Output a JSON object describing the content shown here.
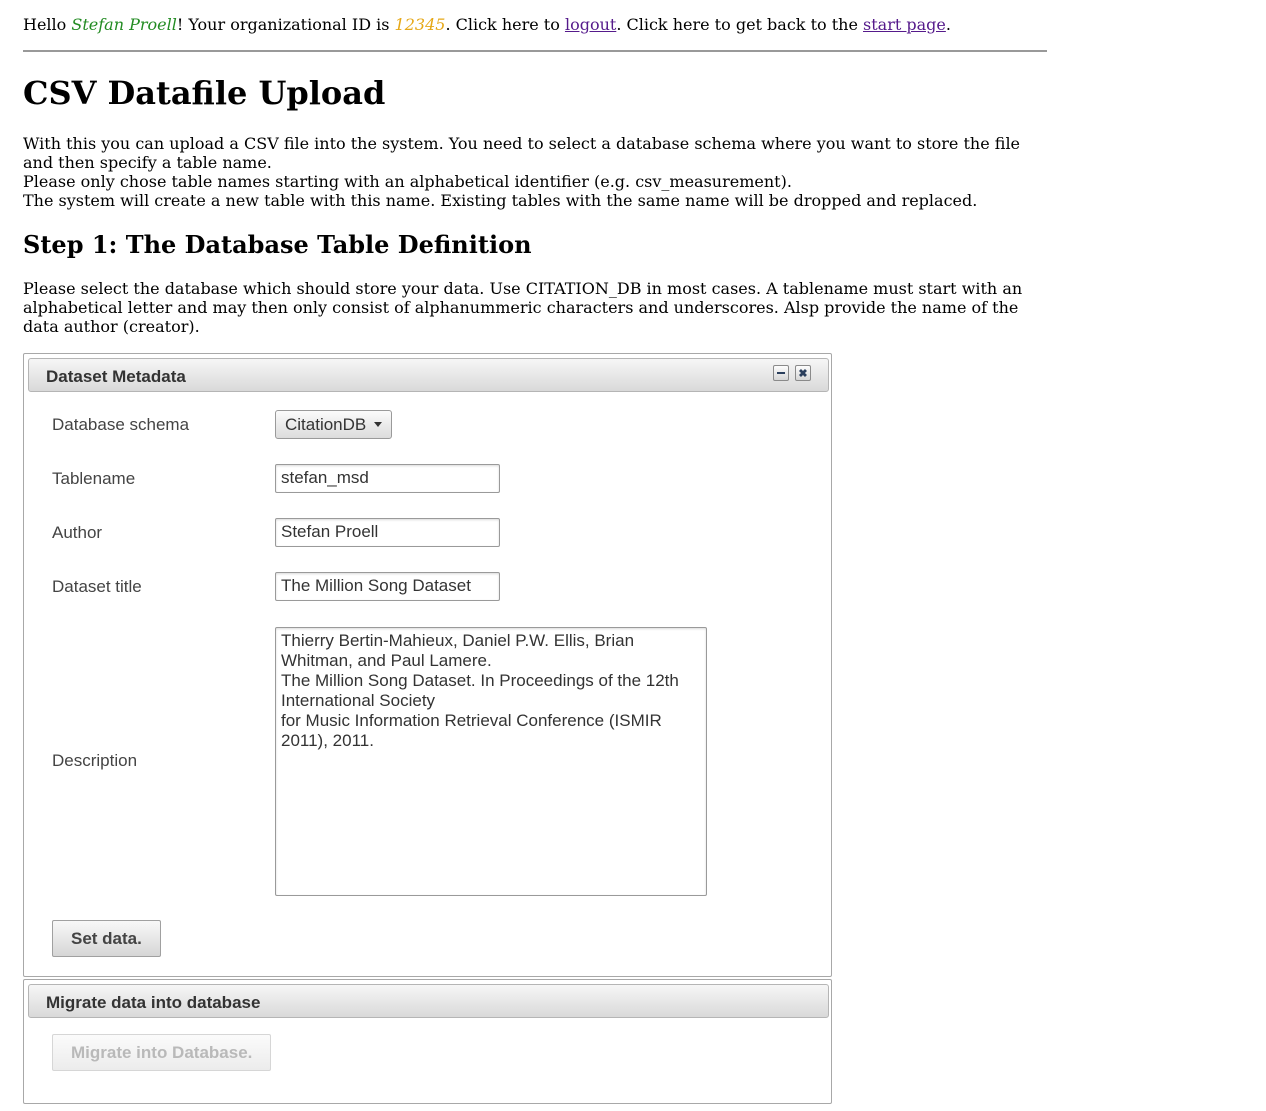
{
  "greeting": {
    "hello": "Hello ",
    "user_name": "Stefan Proell",
    "org_prefix": "! Your organizational ID is ",
    "org_id": "12345",
    "logout_prefix": ". Click here to ",
    "logout_link": "logout",
    "start_prefix": ". Click here to get back to the ",
    "start_link": "start page",
    "end": "."
  },
  "page_title": "CSV Datafile Upload",
  "intro_lines": [
    "With this you can upload a CSV file into the system. You need to select a database schema where you want to store the file and then specify a table name.",
    "Please only chose table names starting with an alphabetical identifier (e.g. csv_measurement).",
    "The system will create a new table with this name. Existing tables with the same name will be dropped and replaced."
  ],
  "step1": {
    "heading": "Step 1: The Database Table Definition",
    "description": "Please select the database which should store your data. Use CITATION_DB in most cases. A tablename must start with an alphabetical letter and may then only consist of alphanummeric characters and underscores. Alsp provide the name of the data author (creator)."
  },
  "metadata_panel": {
    "title": "Dataset Metadata",
    "schema_label": "Database schema",
    "schema_value": "CitationDB",
    "tablename_label": "Tablename",
    "tablename_value": "stefan_msd",
    "author_label": "Author",
    "author_value": "Stefan Proell",
    "dataset_title_label": "Dataset title",
    "dataset_title_value": "The Million Song Dataset",
    "description_label": "Description",
    "description_value": "Thierry Bertin-Mahieux, Daniel P.W. Ellis, Brian Whitman, and Paul Lamere.\nThe Million Song Dataset. In Proceedings of the 12th International Society\nfor Music Information Retrieval Conference (ISMIR 2011), 2011.",
    "set_button": "Set data."
  },
  "migrate_panel": {
    "title": "Migrate data into database",
    "migrate_button": "Migrate into Database."
  }
}
